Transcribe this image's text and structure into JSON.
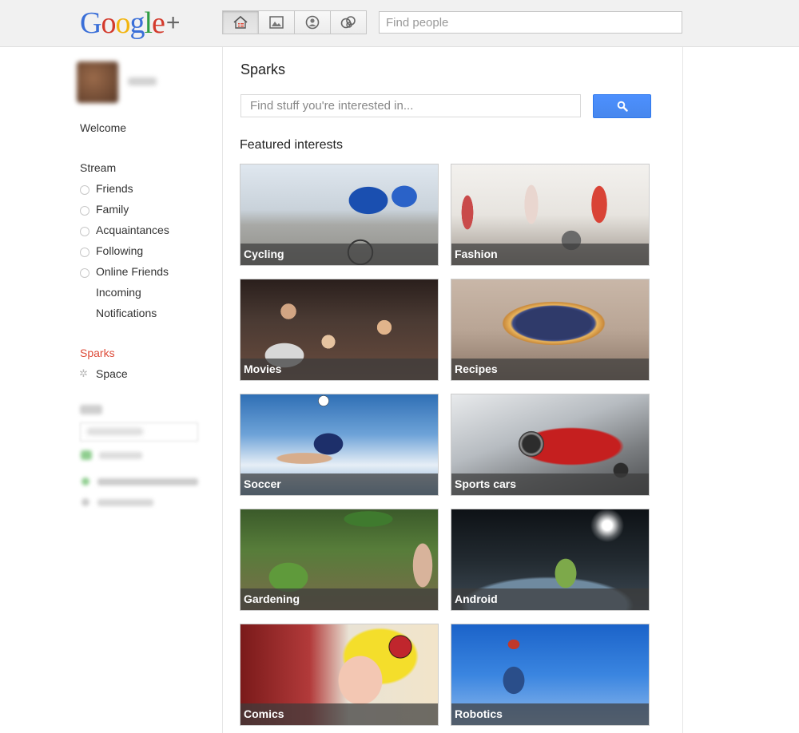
{
  "header": {
    "logo_text": "Google+",
    "nav_buttons": [
      {
        "name": "home",
        "icon": "home-icon"
      },
      {
        "name": "photos",
        "icon": "photo-icon"
      },
      {
        "name": "profile",
        "icon": "profile-icon"
      },
      {
        "name": "circles",
        "icon": "circles-icon"
      }
    ],
    "find_people_placeholder": "Find people"
  },
  "sidebar": {
    "welcome": "Welcome",
    "stream": "Stream",
    "circles": [
      "Friends",
      "Family",
      "Acquaintances",
      "Following",
      "Online Friends"
    ],
    "incoming": "Incoming",
    "notifications": "Notifications",
    "sparks": "Sparks",
    "space": "Space"
  },
  "main": {
    "title": "Sparks",
    "search_placeholder": "Find stuff you're interested in...",
    "featured_title": "Featured interests",
    "tiles": [
      {
        "label": "Cycling"
      },
      {
        "label": "Fashion"
      },
      {
        "label": "Movies"
      },
      {
        "label": "Recipes"
      },
      {
        "label": "Soccer"
      },
      {
        "label": "Sports cars"
      },
      {
        "label": "Gardening"
      },
      {
        "label": "Android"
      },
      {
        "label": "Comics"
      },
      {
        "label": "Robotics"
      }
    ]
  },
  "colors": {
    "accent_red": "#dd4b39",
    "search_blue": "#4d90fe"
  }
}
